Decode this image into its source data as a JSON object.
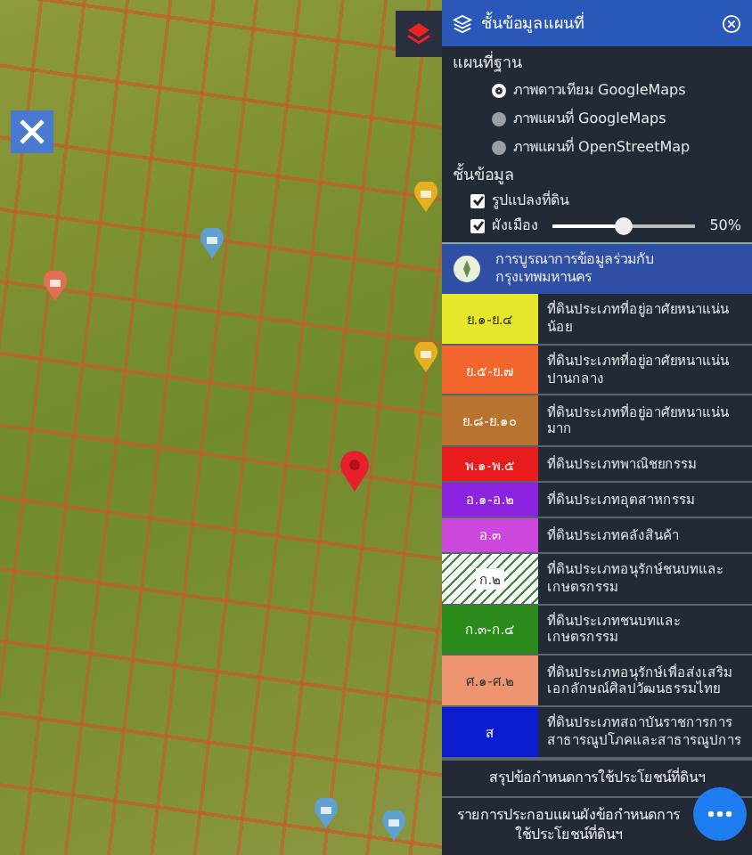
{
  "panel": {
    "title": "ชั้นข้อมูลแผนที่",
    "base_map": {
      "label": "แผนที่ฐาน",
      "options": [
        {
          "label": "ภาพดาวเทียม GoogleMaps",
          "selected": true
        },
        {
          "label": "ภาพแผนที่ GoogleMaps",
          "selected": false
        },
        {
          "label": "ภาพแผนที่ OpenStreetMap",
          "selected": false
        }
      ]
    },
    "layers": {
      "label": "ชั้นข้อมูล",
      "items": [
        {
          "kind": "check",
          "label": "รูปแปลงที่ดิน",
          "checked": true
        },
        {
          "kind": "slider",
          "label": "ผังเมือง",
          "checked": true,
          "level": 0.5,
          "reading": "50%"
        }
      ]
    },
    "banner": {
      "text": "การบูรณาการข้อมูลร่วมกับกรุงเทพมหานคร"
    },
    "legend": [
      {
        "kind": "solid",
        "code": "ย.๑-ย.๔",
        "color": "#e6e62a",
        "description": "ที่ดินประเภทที่อยู่อาศัยหนาแน่นน้อย"
      },
      {
        "kind": "solid",
        "code": "ย.๕-ย.๗",
        "color": "#f2662e",
        "description": "ที่ดินประเภทที่อยู่อาศัยหนาแน่นปานกลาง"
      },
      {
        "kind": "solid",
        "code": "ย.๘-ย.๑๐",
        "color": "#b8742e",
        "description": "ที่ดินประเภทที่อยู่อาศัยหนาแน่นมาก"
      },
      {
        "kind": "solid",
        "code": "พ.๑-พ.๕",
        "color": "#e81c1c",
        "description": "ที่ดินประเภทพาณิชยกรรม"
      },
      {
        "kind": "solid",
        "code": "อ.๑-อ.๒",
        "color": "#8a22e0",
        "description": "ที่ดินประเภทอุตสาหกรรม"
      },
      {
        "kind": "solid",
        "code": "อ.๓",
        "color": "#cc48dc",
        "description": "ที่ดินประเภทคลังสินค้า"
      },
      {
        "kind": "hatched",
        "code": "ก.๒",
        "color": "#3a8a3a",
        "description": "ที่ดินประเภทอนุรักษ์ชนบทและเกษตรกรรม"
      },
      {
        "kind": "solid",
        "code": "ก.๓-ก.๔",
        "color": "#2a8a1a",
        "description": "ที่ดินประเภทชนบทและเกษตรกรรม"
      },
      {
        "kind": "solid",
        "code": "ศ.๑-ศ.๒",
        "color": "#ee9470",
        "description": "ที่ดินประเภทอนุรักษ์เพื่อส่งเสริมเอกลักษณ์ศิลปวัฒนธรรมไทย"
      },
      {
        "kind": "solid",
        "code": "ส",
        "color": "#0a1ed0",
        "description": "ที่ดินประเภทสถาบันราชการการสาธารณูปโภคและสาธารณูปการ"
      }
    ],
    "buttons": [
      "สรุปข้อกำหนดการใช้ประโยชน์ที่ดินฯ",
      "รายการประกอบแผนผังข้อกำหนดการใช้ประโยชน์ที่ดินฯ"
    ]
  }
}
